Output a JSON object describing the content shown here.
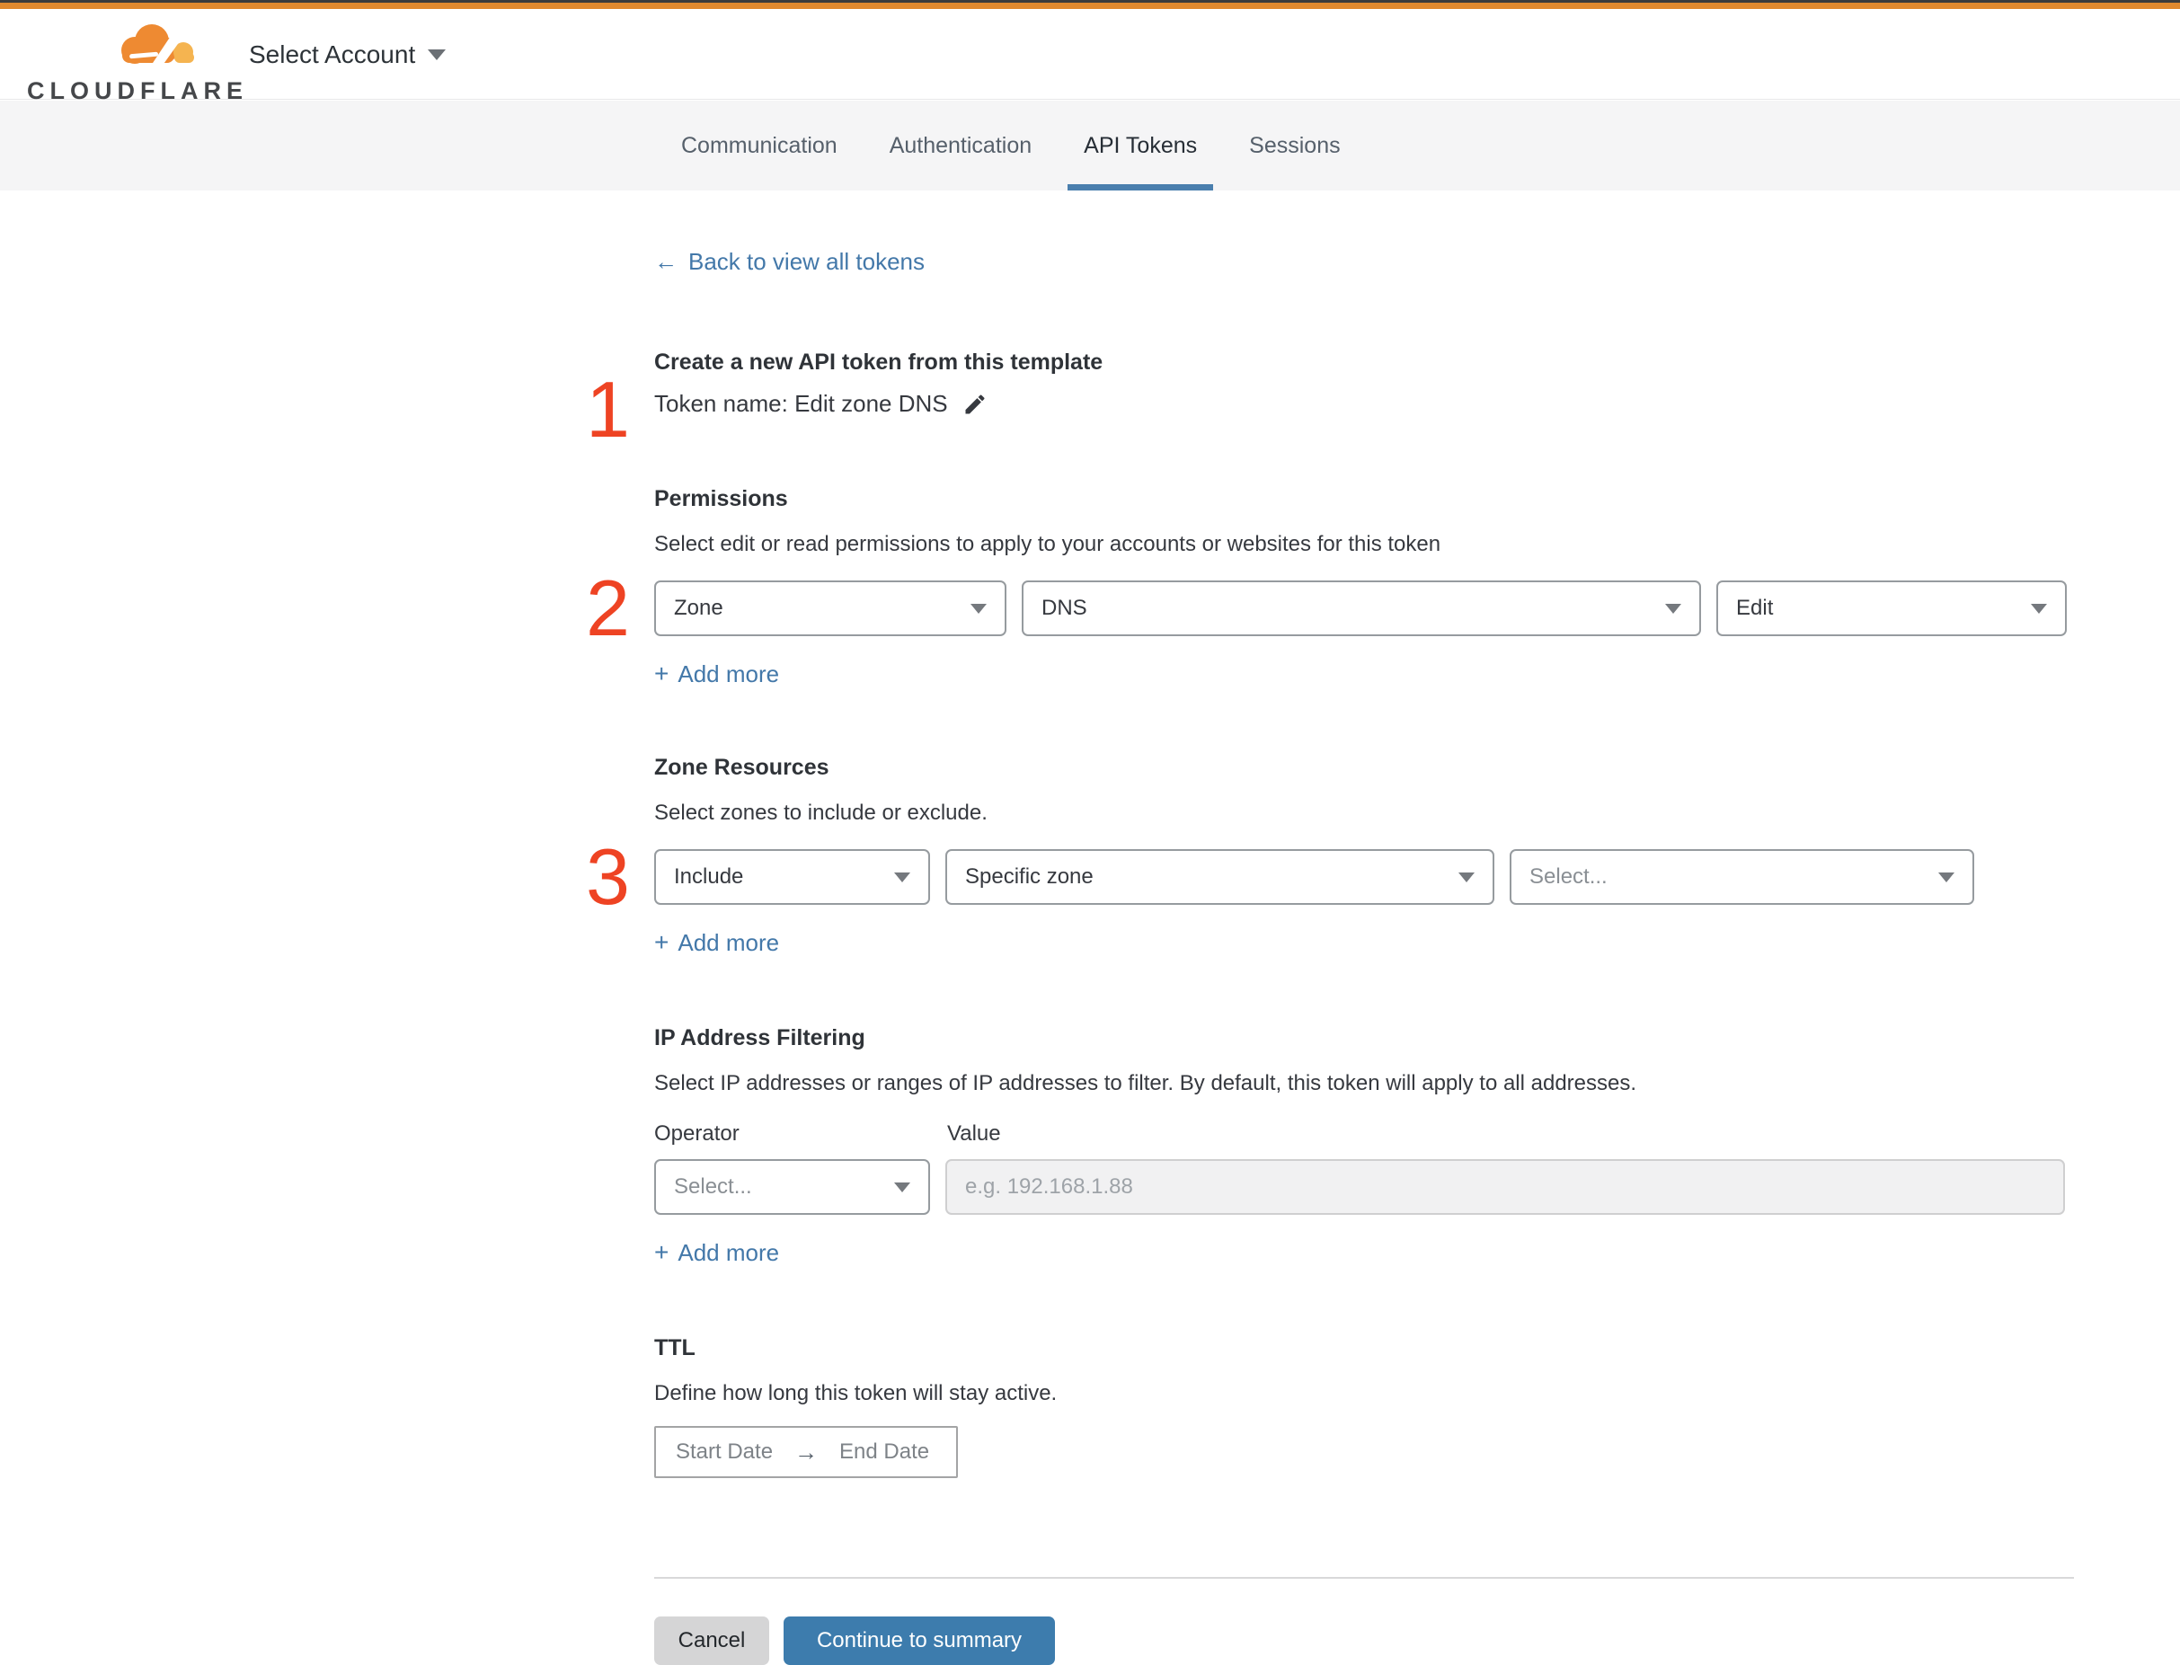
{
  "colors": {
    "brand_orange": "#E0892F",
    "accent_blue": "#4378A9",
    "button_blue": "#3D7CAD",
    "tab_underline_blue": "#4A7FAE",
    "step_number_red": "#EE4323",
    "tabbar_gray": "#F5F5F6",
    "disabled_input_bg": "#F1F1F2"
  },
  "header": {
    "logo_text": "CLOUDFLARE",
    "account_selector": "Select Account"
  },
  "tabs": [
    {
      "label": "Communication",
      "active": false
    },
    {
      "label": "Authentication",
      "active": false
    },
    {
      "label": "API Tokens",
      "active": true
    },
    {
      "label": "Sessions",
      "active": false
    }
  ],
  "back_link": {
    "arrow": "←",
    "label": "Back to view all tokens"
  },
  "template_section": {
    "step": "1",
    "title": "Create a new API token from this template",
    "token_name": "Token name: Edit zone DNS"
  },
  "permissions": {
    "step": "2",
    "title": "Permissions",
    "subtitle": "Select edit or read permissions to apply to your accounts or websites for this token",
    "dropdowns": [
      {
        "value": "Zone"
      },
      {
        "value": "DNS"
      },
      {
        "value": "Edit"
      }
    ],
    "add_more": "Add more"
  },
  "zone_resources": {
    "step": "3",
    "title": "Zone Resources",
    "subtitle": "Select zones to include or exclude.",
    "dropdowns": [
      {
        "value": "Include"
      },
      {
        "value": "Specific zone"
      },
      {
        "value": "Select..."
      }
    ],
    "add_more": "Add more"
  },
  "ip_filtering": {
    "title": "IP Address Filtering",
    "subtitle": "Select IP addresses or ranges of IP addresses to filter. By default, this token will apply to all addresses.",
    "operator_label": "Operator",
    "value_label": "Value",
    "operator_value": "Select...",
    "value_placeholder": "e.g. 192.168.1.88",
    "add_more": "Add more"
  },
  "ttl": {
    "title": "TTL",
    "subtitle": "Define how long this token will stay active.",
    "start_date": "Start Date",
    "arrow": "→",
    "end_date": "End Date"
  },
  "footer": {
    "cancel": "Cancel",
    "continue": "Continue to summary"
  },
  "misc": {
    "plus": "+"
  }
}
